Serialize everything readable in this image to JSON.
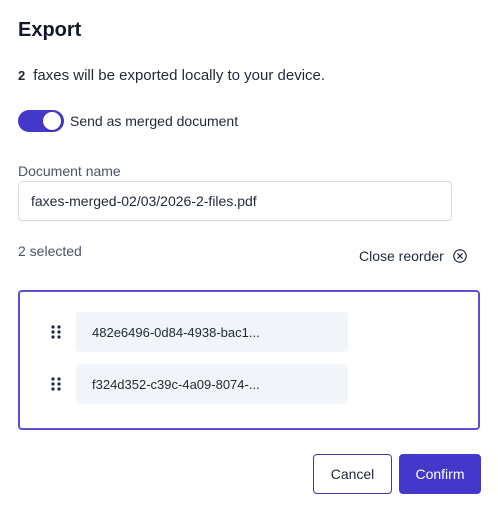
{
  "dialog": {
    "title": "Export",
    "summary_count": "2",
    "summary_text": "faxes will be exported locally to your device.",
    "merge_toggle": {
      "label": "Send as merged document",
      "on": true
    },
    "document_name": {
      "label": "Document name",
      "value": "faxes-merged-02/03/2026-2-files.pdf"
    },
    "selected_count": "2 selected",
    "close_reorder_label": "Close reorder",
    "files": [
      {
        "name": "482e6496-0d84-4938-bac1..."
      },
      {
        "name": "f324d352-c39c-4a09-8074-..."
      }
    ],
    "buttons": {
      "cancel": "Cancel",
      "confirm": "Confirm"
    }
  },
  "colors": {
    "accent": "#4338ca",
    "reorder_border": "#5b4fd6",
    "chip_background": "#f1f4f8"
  },
  "icons": {
    "close_reorder": "circle-x-icon",
    "drag_handle": "drag-handle-icon"
  }
}
